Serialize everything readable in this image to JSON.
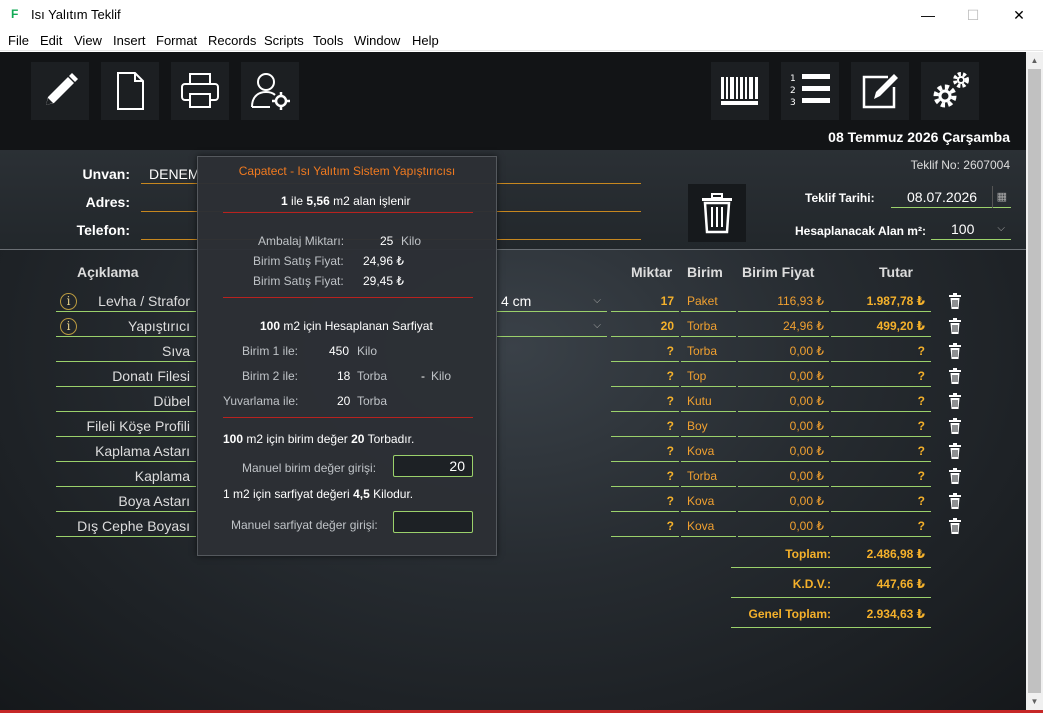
{
  "window": {
    "title": "Isı Yalıtım Teklif",
    "app_icon": "F",
    "controls": {
      "minimize": "—",
      "maximize": "☐",
      "close": "✕"
    }
  },
  "menu": [
    "File",
    "Edit",
    "View",
    "Insert",
    "Format",
    "Records",
    "Scripts",
    "Tools",
    "Window",
    "Help"
  ],
  "toolbar": {
    "left": [
      "pencil-icon",
      "new-document-icon",
      "printer-icon",
      "user-settings-icon"
    ],
    "right": [
      "barcode-icon",
      "numbered-list-icon",
      "edit-note-icon",
      "gear-icon"
    ]
  },
  "header": {
    "date_long": "08 Temmuz 2026 Çarşamba",
    "teklif_no": "Teklif No: 2607004",
    "unvan_label": "Unvan:",
    "unvan_value": "DENEM",
    "adres_label": "Adres:",
    "telefon_label": "Telefon:",
    "teklif_tarihi_label": "Teklif Tarihi:",
    "teklif_tarihi_value": "08.07.2026",
    "alan_label": "Hesaplanacak Alan m²:",
    "alan_value": "100"
  },
  "columns": {
    "aciklama": "Açıklama",
    "miktar": "Miktar",
    "birim": "Birim",
    "birim_fiyat": "Birim Fiyat",
    "tutar": "Tutar"
  },
  "rows": [
    {
      "desc": "Levha / Strafor",
      "info": "i",
      "spec": "4 cm",
      "qty": "17",
      "unit": "Paket",
      "price": "116,93 ₺",
      "total": "1.987,78 ₺"
    },
    {
      "desc": "Yapıştırıcı",
      "info": "i",
      "spec": "",
      "qty": "20",
      "unit": "Torba",
      "price": "24,96 ₺",
      "total": "499,20 ₺"
    },
    {
      "desc": "Sıva",
      "qty": "?",
      "unit": "Torba",
      "price": "0,00 ₺",
      "total": "?"
    },
    {
      "desc": "Donatı Filesi",
      "qty": "?",
      "unit": "Top",
      "price": "0,00 ₺",
      "total": "?"
    },
    {
      "desc": "Dübel",
      "qty": "?",
      "unit": "Kutu",
      "price": "0,00 ₺",
      "total": "?"
    },
    {
      "desc": "Fileli Köşe Profili",
      "qty": "?",
      "unit": "Boy",
      "price": "0,00 ₺",
      "total": "?"
    },
    {
      "desc": "Kaplama Astarı",
      "qty": "?",
      "unit": "Kova",
      "price": "0,00 ₺",
      "total": "?"
    },
    {
      "desc": "Kaplama",
      "qty": "?",
      "unit": "Torba",
      "price": "0,00 ₺",
      "total": "?"
    },
    {
      "desc": "Boya Astarı",
      "qty": "?",
      "unit": "Kova",
      "price": "0,00 ₺",
      "total": "?"
    },
    {
      "desc": "Dış Cephe Boyası",
      "qty": "?",
      "unit": "Kova",
      "price": "0,00 ₺",
      "total": "?"
    }
  ],
  "summary": [
    {
      "label": "Toplam:",
      "value": "2.486,98 ₺"
    },
    {
      "label": "K.D.V.:",
      "value": "447,66 ₺"
    },
    {
      "label": "Genel Toplam:",
      "value": "2.934,63 ₺"
    }
  ],
  "popup": {
    "title": "Capatect - Isı Yalıtım Sistem Yapıştırıcısı",
    "l1_a": "1",
    "l1_b": "ile",
    "l1_c": "5,56",
    "l1_d": "m2 alan işlenir",
    "ambalaj_label": "Ambalaj Miktarı:",
    "ambalaj_value": "25",
    "ambalaj_unit": "Kilo",
    "satis1_label": "Birim Satış Fiyat:",
    "satis1_value": "24,96 ₺",
    "satis2_label": "Birim Satış Fiyat:",
    "satis2_value": "29,45 ₺",
    "h2_a": "100",
    "h2_b": "m2 için Hesaplanan Sarfiyat",
    "birim1_label": "Birim 1 ile:",
    "birim1_value": "450",
    "birim1_unit": "Kilo",
    "birim2_label": "Birim 2 ile:",
    "birim2_value": "18",
    "birim2_unit": "Torba",
    "birim2_dash": "-",
    "birim2_unit2": "Kilo",
    "yuv_label": "Yuvarlama ile:",
    "yuv_value": "20",
    "yuv_unit": "Torba",
    "s3_a": "100",
    "s3_b": "m2 için birim değer",
    "s3_c": "20",
    "s3_d": "Torbadır.",
    "manuel_birim_label": "Manuel birim değer girişi:",
    "manuel_birim_value": "20",
    "s4_a": "1 m2 için sarfiyat değeri",
    "s4_b": "4,5",
    "s4_c": "Kilodur.",
    "manuel_sarfiyat_label": "Manuel sarfiyat değer girişi:",
    "manuel_sarfiyat_value": ""
  },
  "colors": {
    "accent": "#f5b12b",
    "line": "#9bd16b",
    "popup_title": "#f07a20",
    "separator": "#b8221f"
  }
}
